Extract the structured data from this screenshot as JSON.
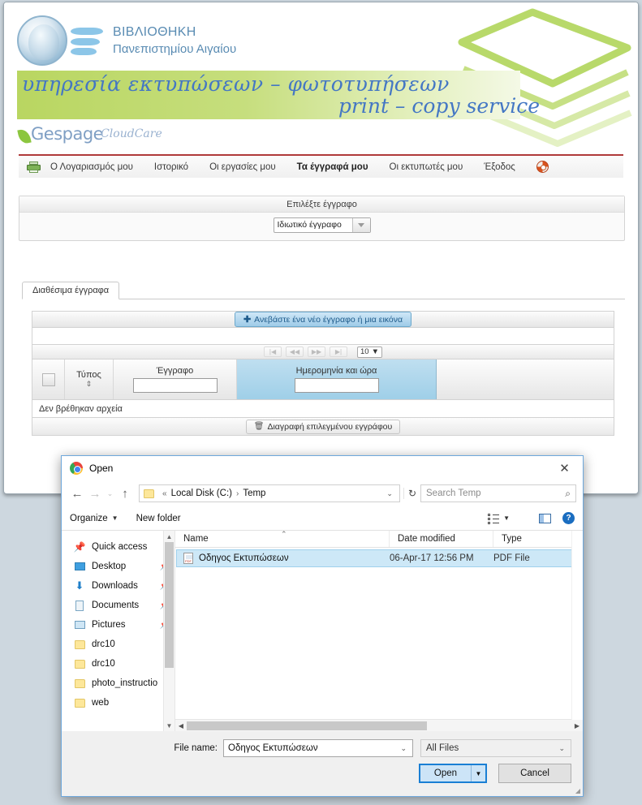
{
  "webpage": {
    "library": {
      "line1": "ΒΙΒΛΙΟΘΗΚΗ",
      "line2": "Πανεπιστημίου Αιγαίου"
    },
    "banner": {
      "line1": "υπηρεσία εκτυπώσεων – φωτοτυπήσεων",
      "line2": "print – copy service"
    },
    "brand": {
      "name": "Gespage",
      "suffix": "CloudCare"
    },
    "nav": {
      "printer_icon": "printer-icon",
      "help_icon": "lifering-icon",
      "items": [
        {
          "label": "Ο Λογαριασμός μου",
          "active": false
        },
        {
          "label": "Ιστορικό",
          "active": false
        },
        {
          "label": "Οι εργασίες μου",
          "active": false
        },
        {
          "label": "Τα έγγραφά μου",
          "active": true
        },
        {
          "label": "Οι εκτυπωτές μου",
          "active": false
        },
        {
          "label": "Έξοδος",
          "active": false
        }
      ]
    },
    "select_panel": {
      "title": "Επιλέξτε έγγραφο",
      "dropdown_value": "Ιδιωτικό έγγραφο"
    },
    "tab": {
      "label": "Διαθέσιμα έγγραφα"
    },
    "table": {
      "upload_button": "Ανεβάστε ένα νέο έγγραφο ή μια εικόνα",
      "upload_icon": "plus-icon",
      "pager": {
        "first": "|◀",
        "prev": "◀◀",
        "next": "▶▶",
        "last": "▶|",
        "page_size": "10"
      },
      "headers": {
        "type": "Τύπος",
        "document": "Έγγραφο",
        "datetime": "Ημερομηνία και ώρα"
      },
      "filters": {
        "document": "",
        "datetime": ""
      },
      "empty_message": "Δεν βρέθηκαν αρχεία",
      "delete_button": "Διαγραφή επιλεγμένου εγγράφου",
      "delete_icon": "trash-icon"
    }
  },
  "dialog": {
    "title": "Open",
    "app_icon": "chrome-icon",
    "close_icon": "close-icon",
    "nav": {
      "back_icon": "arrow-left-icon",
      "forward_icon": "arrow-right-icon",
      "recent_icon": "chevron-down-icon",
      "up_icon": "arrow-up-icon",
      "folder_icon": "folder-icon",
      "breadcrumb_prefix": "«",
      "breadcrumb": [
        "Local Disk (C:)",
        "Temp"
      ],
      "breadcrumb_caret": "⌄",
      "refresh_icon": "↻",
      "search_placeholder": "Search Temp",
      "search_icon": "search-icon"
    },
    "toolbar": {
      "organize": "Organize",
      "new_folder": "New folder",
      "view_icon": "view-list-icon",
      "pane_icon": "preview-pane-icon",
      "help_icon": "help-icon"
    },
    "sidebar": {
      "items": [
        {
          "label": "Quick access",
          "icon": "pin-icon",
          "pinned": false
        },
        {
          "label": "Desktop",
          "icon": "desktop-icon",
          "pinned": true
        },
        {
          "label": "Downloads",
          "icon": "download-icon",
          "pinned": true
        },
        {
          "label": "Documents",
          "icon": "documents-icon",
          "pinned": true
        },
        {
          "label": "Pictures",
          "icon": "pictures-icon",
          "pinned": true
        },
        {
          "label": "drc10",
          "icon": "folder-icon",
          "pinned": false
        },
        {
          "label": "drc10",
          "icon": "folder-icon",
          "pinned": false
        },
        {
          "label": "photo_instructio",
          "icon": "folder-icon",
          "pinned": false
        },
        {
          "label": "web",
          "icon": "folder-icon",
          "pinned": false
        }
      ]
    },
    "filelist": {
      "columns": [
        "Name",
        "Date modified",
        "Type"
      ],
      "sort_caret": "⌃",
      "rows": [
        {
          "name": "Οδηγος Εκτυπώσεων",
          "date_modified": "06-Apr-17 12:56 PM",
          "type": "PDF File",
          "icon": "pdf-file-icon",
          "selected": true
        }
      ]
    },
    "footer": {
      "file_name_label": "File name:",
      "file_name_value": "Οδηγος Εκτυπώσεων",
      "file_type_value": "All Files",
      "caret_icon": "chevron-down-icon",
      "open_button": "Open",
      "open_split_icon": "▼",
      "cancel_button": "Cancel"
    }
  }
}
